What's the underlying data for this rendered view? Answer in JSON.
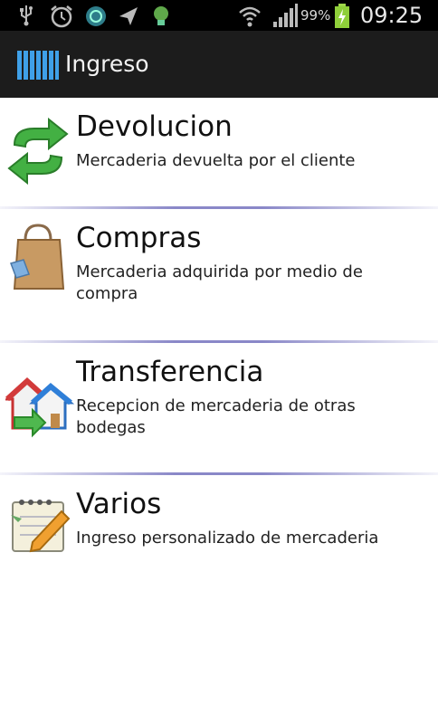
{
  "status_bar": {
    "icons": [
      "usb-icon",
      "alarm-icon",
      "sync-icon",
      "navigation-icon",
      "bulb-icon",
      "wifi-icon",
      "signal-icon",
      "battery-icon"
    ],
    "battery_pct": "99%",
    "time": "09:25"
  },
  "action_bar": {
    "title": "Ingreso",
    "app_icon": "barcode-icon"
  },
  "items": [
    {
      "title": "Devolucion",
      "subtitle": "Mercaderia devuelta por el cliente",
      "icon": "refresh-arrows-icon"
    },
    {
      "title": "Compras",
      "subtitle": "Mercaderia adquirida por medio de compra",
      "icon": "shopping-bag-icon"
    },
    {
      "title": "Transferencia",
      "subtitle": "Recepcion de mercaderia de otras bodegas",
      "icon": "house-transfer-icon"
    },
    {
      "title": "Varios",
      "subtitle": "Ingreso personalizado de mercaderia",
      "icon": "notepad-pencil-icon"
    }
  ]
}
